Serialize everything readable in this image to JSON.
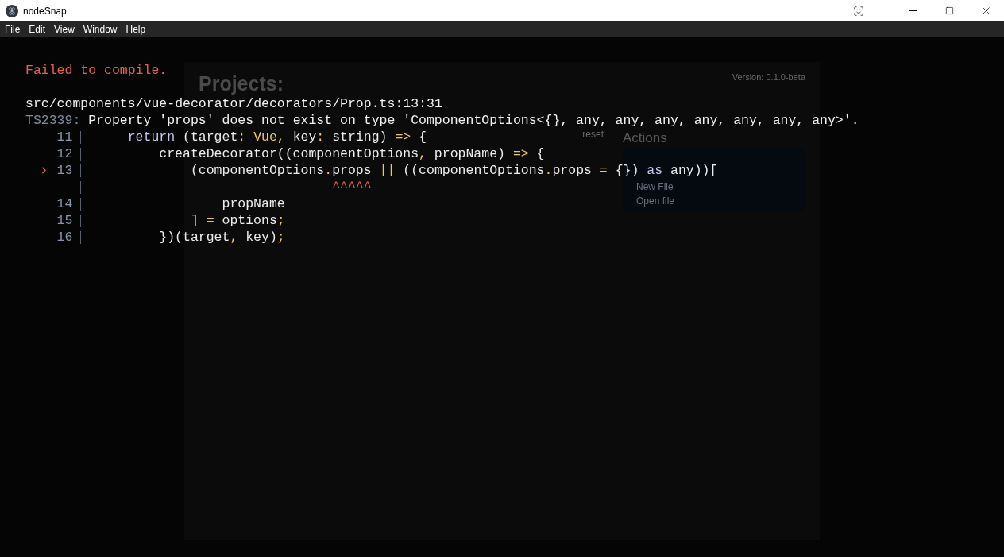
{
  "window": {
    "title": "nodeSnap"
  },
  "menu": [
    "File",
    "Edit",
    "View",
    "Window",
    "Help"
  ],
  "background_app": {
    "heading": "Projects:",
    "version": "Version: 0.1.0-beta",
    "reset": "reset",
    "actions_heading": "Actions",
    "actions": [
      "New File",
      "Open file"
    ]
  },
  "error_overlay": {
    "headline": "Failed to compile.",
    "file": "src/components/vue-decorator/decorators/Prop.ts:13:31",
    "code": "TS2339:",
    "message": "Property 'props' does not exist on type 'ComponentOptions<{}, any, any, any, any, any, any, any>'.",
    "lines": [
      {
        "number": "11",
        "highlighted": false,
        "tokens": [
          {
            "kind": "keyword",
            "text": "    return"
          },
          {
            "kind": "plain",
            "text": " (target"
          },
          {
            "kind": "accent",
            "text": ": Vue,"
          },
          {
            "kind": "plain",
            "text": " key"
          },
          {
            "kind": "accent",
            "text": ":"
          },
          {
            "kind": "plain",
            "text": " string) "
          },
          {
            "kind": "accent",
            "text": "=>"
          },
          {
            "kind": "plain",
            "text": " {"
          }
        ]
      },
      {
        "number": "12",
        "highlighted": false,
        "tokens": [
          {
            "kind": "plain",
            "text": "        createDecorator((componentOptions"
          },
          {
            "kind": "accent",
            "text": ","
          },
          {
            "kind": "plain",
            "text": " propName) "
          },
          {
            "kind": "accent",
            "text": "=>"
          },
          {
            "kind": "plain",
            "text": " {"
          }
        ]
      },
      {
        "number": "13",
        "highlighted": true,
        "tokens": [
          {
            "kind": "plain",
            "text": "            (componentOptions"
          },
          {
            "kind": "accent",
            "text": "."
          },
          {
            "kind": "plain",
            "text": "props "
          },
          {
            "kind": "accent",
            "text": "||"
          },
          {
            "kind": "plain",
            "text": " ((componentOptions"
          },
          {
            "kind": "accent",
            "text": "."
          },
          {
            "kind": "plain",
            "text": "props "
          },
          {
            "kind": "accent",
            "text": "="
          },
          {
            "kind": "plain",
            "text": " {}) "
          },
          {
            "kind": "keyword",
            "text": "as"
          },
          {
            "kind": "plain",
            "text": " any))["
          }
        ]
      },
      {
        "highlighted": false,
        "tokens": [
          {
            "kind": "pointer",
            "text": "                              ^^^^^"
          }
        ]
      },
      {
        "number": "14",
        "highlighted": false,
        "tokens": [
          {
            "kind": "plain",
            "text": "                propName"
          }
        ]
      },
      {
        "number": "15",
        "highlighted": false,
        "tokens": [
          {
            "kind": "plain",
            "text": "            ] "
          },
          {
            "kind": "accent",
            "text": "="
          },
          {
            "kind": "plain",
            "text": " options"
          },
          {
            "kind": "accent",
            "text": ";"
          }
        ]
      },
      {
        "number": "16",
        "highlighted": false,
        "tokens": [
          {
            "kind": "plain",
            "text": "        })(target"
          },
          {
            "kind": "accent",
            "text": ","
          },
          {
            "kind": "plain",
            "text": " key)"
          },
          {
            "kind": "accent",
            "text": ";"
          }
        ]
      }
    ]
  }
}
